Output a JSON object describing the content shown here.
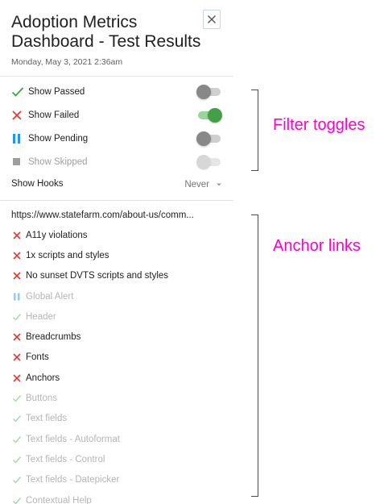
{
  "header": {
    "title": "Adoption Metrics Dashboard - Test Results",
    "timestamp": "Monday, May 3, 2021 2:36am"
  },
  "filters": [
    {
      "label": "Show Passed",
      "icon": "check-icon",
      "state": "off",
      "enabled": true
    },
    {
      "label": "Show Failed",
      "icon": "x-icon",
      "state": "on",
      "enabled": true
    },
    {
      "label": "Show Pending",
      "icon": "pause-icon",
      "state": "off",
      "enabled": true
    },
    {
      "label": "Show Skipped",
      "icon": "square-icon",
      "state": "off",
      "enabled": false
    }
  ],
  "hooks": {
    "label": "Show Hooks",
    "value": "Never"
  },
  "suite": {
    "url": "https://www.statefarm.com/about-us/comm...",
    "tests": [
      {
        "label": "A11y violations",
        "status": "failed"
      },
      {
        "label": "1x scripts and styles",
        "status": "failed"
      },
      {
        "label": "No sunset DVTS scripts and styles",
        "status": "failed"
      },
      {
        "label": "Global Alert",
        "status": "pending"
      },
      {
        "label": "Header",
        "status": "passed"
      },
      {
        "label": "Breadcrumbs",
        "status": "failed"
      },
      {
        "label": "Fonts",
        "status": "failed"
      },
      {
        "label": "Anchors",
        "status": "failed"
      },
      {
        "label": "Buttons",
        "status": "passed"
      },
      {
        "label": "Text fields",
        "status": "passed"
      },
      {
        "label": "Text fields - Autoformat",
        "status": "passed"
      },
      {
        "label": "Text fields - Control",
        "status": "passed"
      },
      {
        "label": "Text fields - Datepicker",
        "status": "passed"
      },
      {
        "label": "Contextual Help",
        "status": "passed"
      }
    ]
  },
  "annotations": {
    "filter_toggles": "Filter toggles",
    "anchor_links": "Anchor links",
    "color": "#ff00c8"
  },
  "colors": {
    "passed": "#43a047",
    "failed": "#e53935",
    "pending": "#2196f3",
    "skipped": "#9e9e9e",
    "passed_dim": "#a5d6a7",
    "pending_dim": "#90caf9"
  }
}
